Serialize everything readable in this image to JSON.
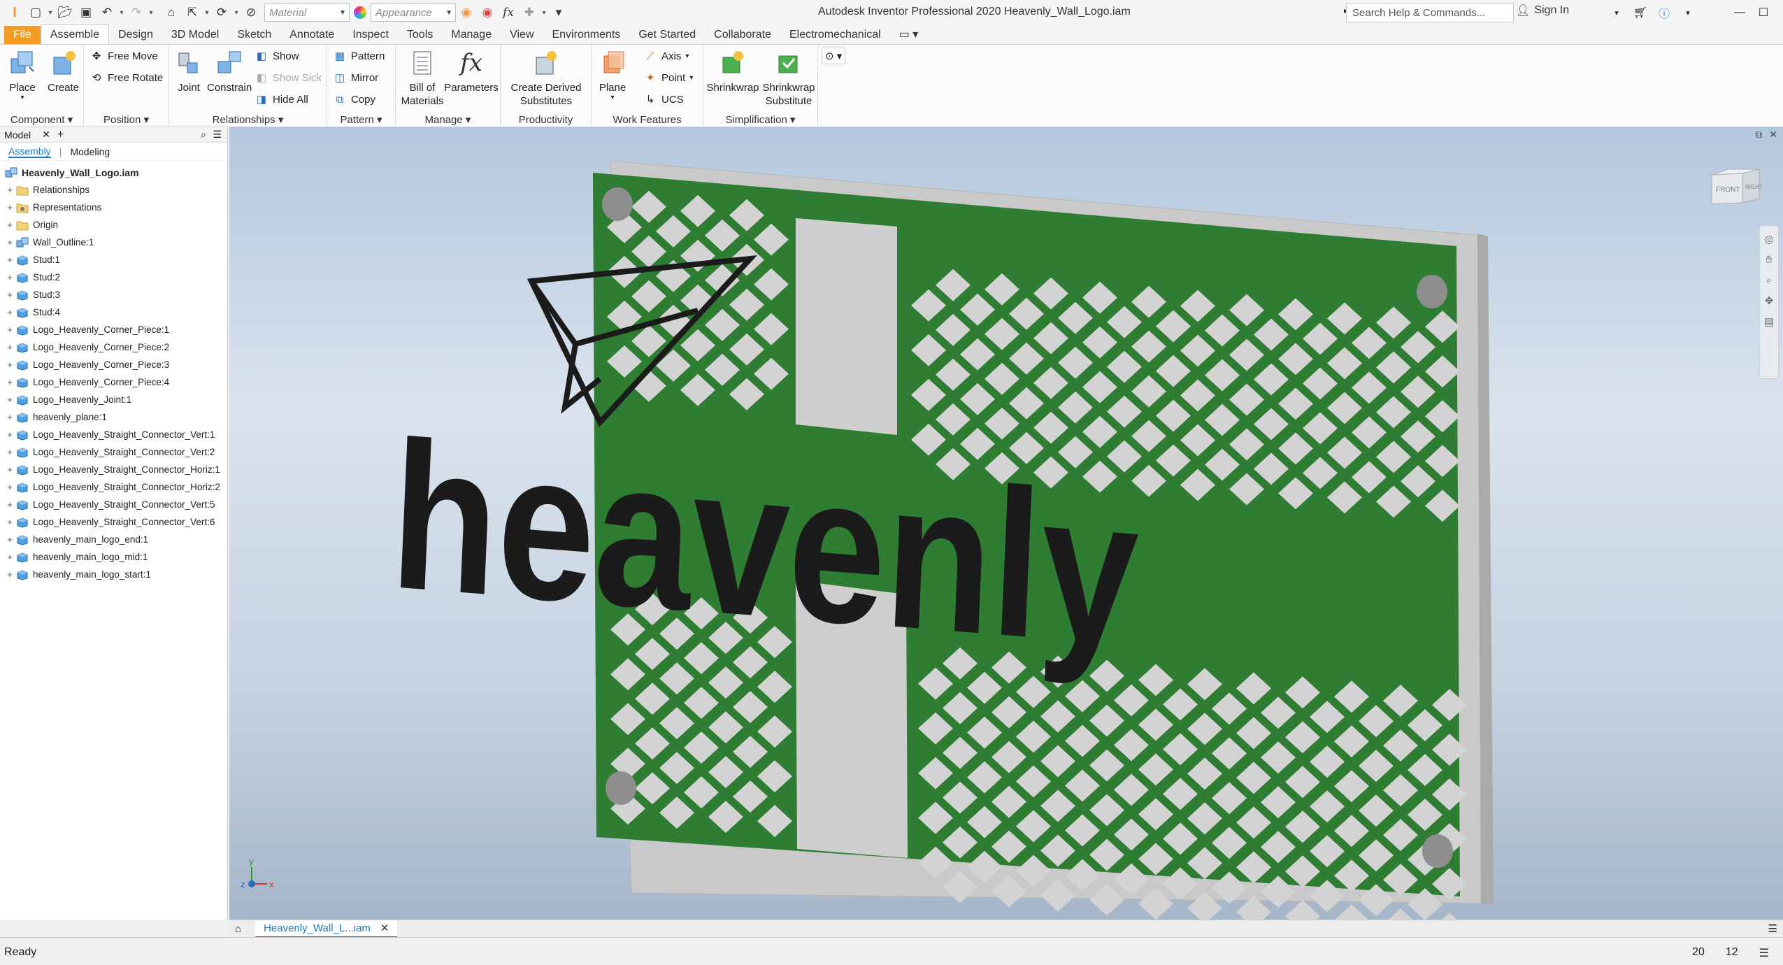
{
  "titlebar": {
    "material_placeholder": "Material",
    "appearance_placeholder": "Appearance",
    "app_title": "Autodesk Inventor Professional 2020   Heavenly_Wall_Logo.iam",
    "search_placeholder": "Search Help & Commands...",
    "sign_in": "Sign In"
  },
  "ribbon_tabs": [
    "File",
    "Assemble",
    "Design",
    "3D Model",
    "Sketch",
    "Annotate",
    "Inspect",
    "Tools",
    "Manage",
    "View",
    "Environments",
    "Get Started",
    "Collaborate",
    "Electromechanical"
  ],
  "ribbon": {
    "component": {
      "title": "Component",
      "place": "Place",
      "create": "Create"
    },
    "position": {
      "title": "Position",
      "free_move": "Free Move",
      "free_rotate": "Free Rotate"
    },
    "relationships": {
      "title": "Relationships",
      "joint": "Joint",
      "constrain": "Constrain",
      "show": "Show",
      "show_sick": "Show Sick",
      "hide_all": "Hide All"
    },
    "pattern": {
      "title": "Pattern",
      "pattern": "Pattern",
      "mirror": "Mirror",
      "copy": "Copy"
    },
    "manage": {
      "title": "Manage",
      "bom_line1": "Bill of",
      "bom_line2": "Materials",
      "parameters": "Parameters"
    },
    "productivity": {
      "title": "Productivity",
      "cds_line1": "Create Derived",
      "cds_line2": "Substitutes"
    },
    "work_features": {
      "title": "Work Features",
      "plane": "Plane",
      "axis": "Axis",
      "point": "Point",
      "ucs": "UCS"
    },
    "simplification": {
      "title": "Simplification",
      "shrinkwrap": "Shrinkwrap",
      "sws_line1": "Shrinkwrap",
      "sws_line2": "Substitute"
    }
  },
  "browser": {
    "header": "Model",
    "tab_assembly": "Assembly",
    "tab_modeling": "Modeling",
    "root": "Heavenly_Wall_Logo.iam",
    "items": [
      {
        "label": "Relationships",
        "icon": "folder-icon"
      },
      {
        "label": "Representations",
        "icon": "representations-icon"
      },
      {
        "label": "Origin",
        "icon": "folder-icon"
      },
      {
        "label": "Wall_Outline:1",
        "icon": "subassembly-icon"
      },
      {
        "label": "Stud:1",
        "icon": "part-icon"
      },
      {
        "label": "Stud:2",
        "icon": "part-icon"
      },
      {
        "label": "Stud:3",
        "icon": "part-icon"
      },
      {
        "label": "Stud:4",
        "icon": "part-icon"
      },
      {
        "label": "Logo_Heavenly_Corner_Piece:1",
        "icon": "part-icon"
      },
      {
        "label": "Logo_Heavenly_Corner_Piece:2",
        "icon": "part-icon"
      },
      {
        "label": "Logo_Heavenly_Corner_Piece:3",
        "icon": "part-icon"
      },
      {
        "label": "Logo_Heavenly_Corner_Piece:4",
        "icon": "part-icon"
      },
      {
        "label": "Logo_Heavenly_Joint:1",
        "icon": "part-icon"
      },
      {
        "label": "heavenly_plane:1",
        "icon": "part-icon"
      },
      {
        "label": "Logo_Heavenly_Straight_Connector_Vert:1",
        "icon": "part-icon"
      },
      {
        "label": "Logo_Heavenly_Straight_Connector_Vert:2",
        "icon": "part-icon"
      },
      {
        "label": "Logo_Heavenly_Straight_Connector_Horiz:1",
        "icon": "part-icon"
      },
      {
        "label": "Logo_Heavenly_Straight_Connector_Horiz:2",
        "icon": "part-icon"
      },
      {
        "label": "Logo_Heavenly_Straight_Connector_Vert:5",
        "icon": "part-icon"
      },
      {
        "label": "Logo_Heavenly_Straight_Connector_Vert:6",
        "icon": "part-icon"
      },
      {
        "label": "heavenly_main_logo_end:1",
        "icon": "part-icon"
      },
      {
        "label": "heavenly_main_logo_mid:1",
        "icon": "part-icon"
      },
      {
        "label": "heavenly_main_logo_start:1",
        "icon": "part-icon"
      }
    ]
  },
  "viewport": {
    "logo_text": "heavenly",
    "viewcube_front": "FRONT",
    "viewcube_right": "RIGHT",
    "colors": {
      "green": "#2e7d32",
      "plate": "#d2d2d2",
      "text": "#1b1b1b"
    }
  },
  "doc_tab": "Heavenly_Wall_L...iam",
  "status": {
    "text": "Ready",
    "num1": "20",
    "num2": "12"
  }
}
